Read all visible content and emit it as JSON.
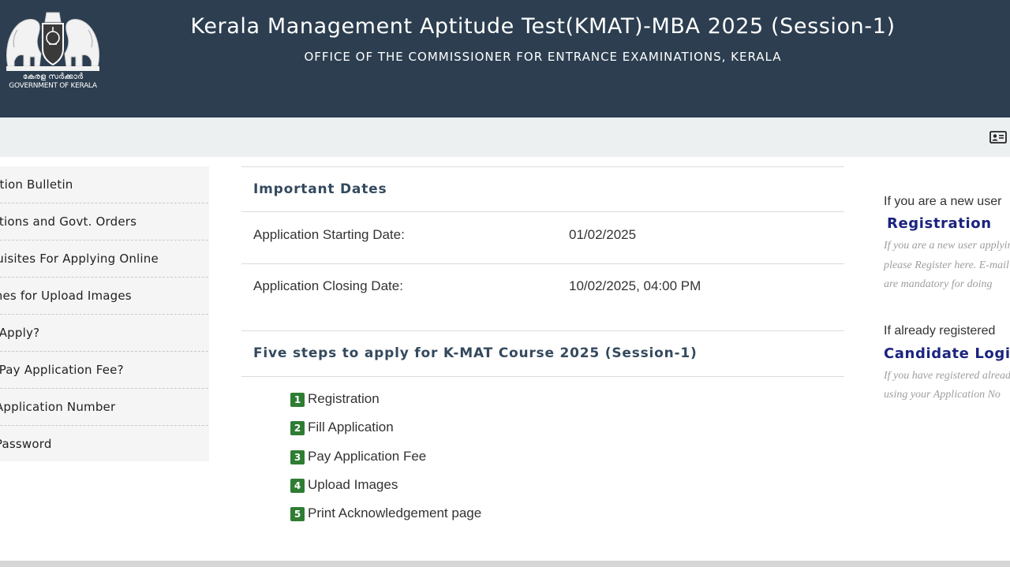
{
  "header": {
    "emblem_icon": "kerala-emblem-icon",
    "gov_name_ml": "കേരള സർക്കാർ",
    "gov_name_en": "GOVERNMENT OF KERALA",
    "title": "Kerala Management Aptitude Test(KMAT)-MBA 2025 (Session-1)",
    "subtitle": "OFFICE OF THE COMMISSIONER FOR ENTRANCE EXAMINATIONS, KERALA",
    "bg_color": "#2c3e50"
  },
  "topbar": {
    "icon": "id-card-icon"
  },
  "sidebar": {
    "items": [
      {
        "label": "Information Bulletin"
      },
      {
        "label": "Notifications and Govt. Orders"
      },
      {
        "label": "Pre-requisites For Applying Online"
      },
      {
        "label": "Guidelines for Upload Images"
      },
      {
        "label": "How to Apply?"
      },
      {
        "label": "How to Pay Application Fee?"
      },
      {
        "label": "Forgot Application Number"
      },
      {
        "label": "Forgot Password"
      }
    ]
  },
  "important_dates": {
    "title": "Important Dates",
    "rows": [
      {
        "label": "Application Starting Date:",
        "value": "01/02/2025"
      },
      {
        "label": "Application Closing Date:",
        "value": "10/02/2025, 04:00 PM"
      }
    ]
  },
  "steps": {
    "title": "Five steps to apply for K-MAT Course 2025 (Session-1)",
    "items": [
      {
        "num": "1",
        "label": "Registration"
      },
      {
        "num": "2",
        "label": "Fill Application"
      },
      {
        "num": "3",
        "label": "Pay Application Fee"
      },
      {
        "num": "4",
        "label": "Upload Images"
      },
      {
        "num": "5",
        "label": "Print Acknowledgement page"
      }
    ],
    "badge_color": "#2e7d32"
  },
  "right_panel": {
    "new_user_heading": "If you are a new user",
    "registration_link": "Registration",
    "registration_note_1": "If you are a new user applying,",
    "registration_note_2": "please Register here. E-mail",
    "registration_note_3": "are mandatory for doing",
    "registered_heading": "If already registered",
    "login_link": "Candidate Login",
    "login_note_1": "If you have registered already",
    "login_note_2": "using your Application No",
    "link_color": "#1a237e"
  }
}
